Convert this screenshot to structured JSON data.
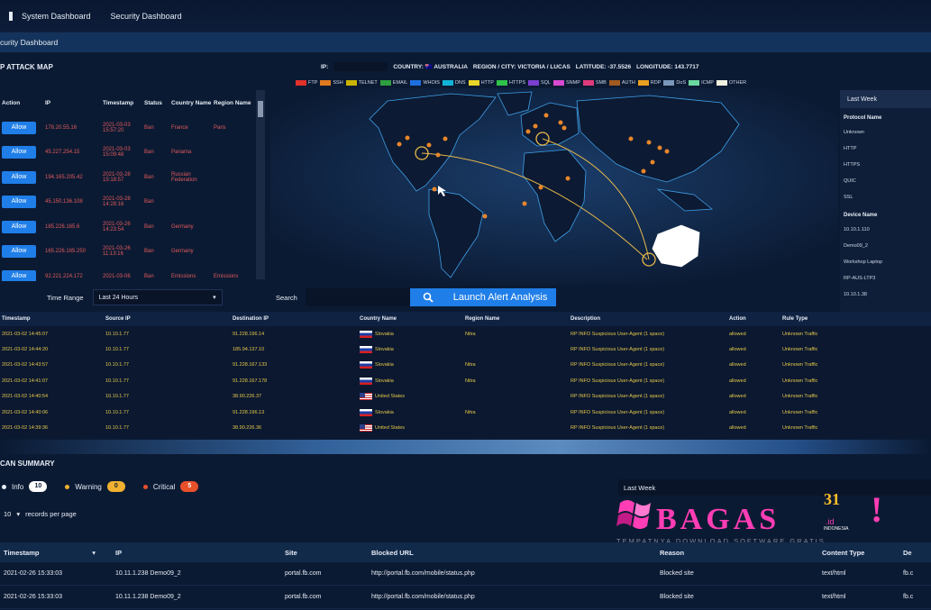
{
  "nav": {
    "items": [
      "System Dashboard",
      "Security Dashboard"
    ]
  },
  "subbar": {
    "title": "curity Dashboard"
  },
  "attack_map": {
    "title": "P ATTACK MAP",
    "ip_label": "IP:",
    "country_label": "COUNTRY: 🇦🇺 AUSTRALIA",
    "region_label": "REGION / CITY: VICTORIA / LUCAS",
    "lat_label": "LATITUDE: -37.5526",
    "lon_label": "LONGITUDE: 143.7717",
    "legend": [
      {
        "name": "FTP",
        "color": "#e0312b"
      },
      {
        "name": "SSH",
        "color": "#e07a1f"
      },
      {
        "name": "TELNET",
        "color": "#c9b400"
      },
      {
        "name": "EMAIL",
        "color": "#2e9e3e"
      },
      {
        "name": "WHOIS",
        "color": "#1d6fe0"
      },
      {
        "name": "DNS",
        "color": "#13b3d8"
      },
      {
        "name": "HTTP",
        "color": "#e8d52a"
      },
      {
        "name": "HTTPS",
        "color": "#2fc24a"
      },
      {
        "name": "SQL",
        "color": "#7a3fd0"
      },
      {
        "name": "SNMP",
        "color": "#d84ad0"
      },
      {
        "name": "SMB",
        "color": "#e03a7c"
      },
      {
        "name": "AUTH",
        "color": "#a05a20"
      },
      {
        "name": "RDP",
        "color": "#e8a020"
      },
      {
        "name": "DoS",
        "color": "#7a96b8"
      },
      {
        "name": "ICMP",
        "color": "#6ad8a0"
      },
      {
        "name": "OTHER",
        "color": "#f0f0e0"
      }
    ]
  },
  "attack_table": {
    "headers": [
      "Action",
      "IP",
      "Timestamp",
      "Status",
      "Country Name",
      "Region Name"
    ],
    "button_label": "Allow",
    "rows": [
      {
        "ip": "178.20.55.16",
        "ts": "2021-03-03 15:57:20",
        "status": "Ban",
        "country": "France",
        "region": "Paris"
      },
      {
        "ip": "45.227.254.15",
        "ts": "2021-03-03 15:09:48",
        "status": "Ban",
        "country": "Panama",
        "region": ""
      },
      {
        "ip": "194.165.205.42",
        "ts": "2021-03-28 15:18:57",
        "status": "Ban",
        "country": "Russian Federation",
        "region": ""
      },
      {
        "ip": "45.150.136.108",
        "ts": "2021-03-28 14:28:16",
        "status": "Ban",
        "country": "",
        "region": ""
      },
      {
        "ip": "185.226.165.6",
        "ts": "2021-03-26 14:23:54",
        "status": "Ban",
        "country": "Germany",
        "region": ""
      },
      {
        "ip": "165.226.165.250",
        "ts": "2021-03-26 11:13:16",
        "status": "Ban",
        "country": "Germany",
        "region": ""
      },
      {
        "ip": "92.221.224.172",
        "ts": "2021-03-06",
        "status": "Ban",
        "country": "Emissions",
        "region": "Emissions"
      }
    ]
  },
  "controls": {
    "time_range_label": "Time Range",
    "time_range_value": "Last 24 Hours",
    "search_label": "Search",
    "launch_label": "Launch Alert Analysis"
  },
  "right_panel": {
    "header": "Last Week",
    "protocol_title": "Protocol Name",
    "protocols": [
      "Unknown",
      "HTTP",
      "HTTPS",
      "QUIC",
      "SSL"
    ],
    "device_title": "Device Name",
    "devices": [
      "10.10.1.110",
      "Demo09_2",
      "Workshop Laptop",
      "RP-AUS-LTP3",
      "10.10.1.38"
    ]
  },
  "events_table": {
    "headers": [
      "Timestamp",
      "Source IP",
      "Destination IP",
      "Country Name",
      "Region Name",
      "Description",
      "Action",
      "Rule Type"
    ],
    "rows": [
      {
        "ts": "2021-03-02 14:45:07",
        "sip": "10.10.1.77",
        "dip": "91.228.196.14",
        "flag": "sk",
        "country": "Slovakia",
        "region": "Nitra",
        "desc": "RP INFO Suspicious User-Agent (1 space)",
        "action": "allowed",
        "rule": "Unknown Traffic"
      },
      {
        "ts": "2021-03-02 14:44:20",
        "sip": "10.10.1.77",
        "dip": "185.94.137.10",
        "flag": "sk",
        "country": "Slovakia",
        "region": "",
        "desc": "RP INFO Suspicious User-Agent (1 space)",
        "action": "allowed",
        "rule": "Unknown Traffic"
      },
      {
        "ts": "2021-03-02 14:43:57",
        "sip": "10.10.1.77",
        "dip": "91.228.167.133",
        "flag": "sk",
        "country": "Slovakia",
        "region": "Nitra",
        "desc": "RP INFO Suspicious User-Agent (1 space)",
        "action": "allowed",
        "rule": "Unknown Traffic"
      },
      {
        "ts": "2021-03-02 14:41:07",
        "sip": "10.10.1.77",
        "dip": "91.228.167.178",
        "flag": "sk",
        "country": "Slovakia",
        "region": "Nitra",
        "desc": "RP INFO Suspicious User-Agent (1 space)",
        "action": "allowed",
        "rule": "Unknown Traffic"
      },
      {
        "ts": "2021-03-02 14:40:54",
        "sip": "10.10.1.77",
        "dip": "38.90.226.37",
        "flag": "us",
        "country": "United States",
        "region": "",
        "desc": "RP INFO Suspicious User-Agent (1 space)",
        "action": "allowed",
        "rule": "Unknown Traffic"
      },
      {
        "ts": "2021-03-02 14:40:06",
        "sip": "10.10.1.77",
        "dip": "91.228.196.13",
        "flag": "sk",
        "country": "Slovakia",
        "region": "Nitra",
        "desc": "RP INFO Suspicious User-Agent (1 space)",
        "action": "allowed",
        "rule": "Unknown Traffic"
      },
      {
        "ts": "2021-03-02 14:39:36",
        "sip": "10.10.1.77",
        "dip": "38.90.226.36",
        "flag": "us",
        "country": "United States",
        "region": "",
        "desc": "RP INFO Suspicious User-Agent (1 space)",
        "action": "allowed",
        "rule": "Unknown Traffic"
      }
    ]
  },
  "scan_summary": {
    "title": "CAN SUMMARY",
    "info_label": "Info",
    "info_count": "10",
    "warning_label": "Warning",
    "warning_count": "0",
    "critical_label": "Critical",
    "critical_count": "5",
    "period_value": "Last Week",
    "per_page_value": "10",
    "per_page_label": "records per page"
  },
  "watermark": {
    "brand": "BAGAS",
    "num": "31",
    "tld": ".id",
    "country": "INDONESIA",
    "excl": "!",
    "tagline": "TEMPATNYA DOWNLOAD SOFTWARE GRATIS"
  },
  "blocked_table": {
    "headers": [
      "Timestamp",
      "IP",
      "Site",
      "Blocked URL",
      "Reason",
      "Content Type",
      "De"
    ],
    "rows": [
      {
        "ts": "2021-02-26 15:33:03",
        "ip": "10.11.1.238 Demo09_2",
        "site": "portal.fb.com",
        "url": "http://portal.fb.com/mobile/status.php",
        "reason": "Blocked site",
        "ctype": "text/html",
        "d": "fb.c"
      },
      {
        "ts": "2021-02-26 15:33:03",
        "ip": "10.11.1.238 Demo09_2",
        "site": "portal.fb.com",
        "url": "http://portal.fb.com/mobile/status.php",
        "reason": "Blocked site",
        "ctype": "text/html",
        "d": "fb.c"
      }
    ]
  }
}
